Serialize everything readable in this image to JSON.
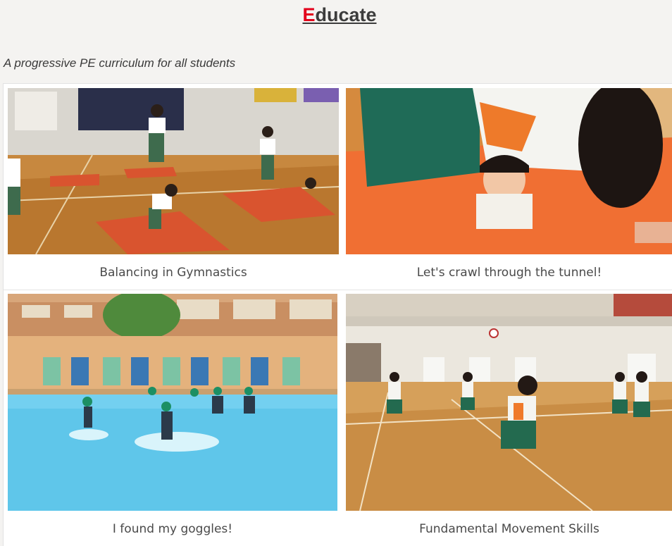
{
  "header": {
    "title_first_letter": "E",
    "title_rest": "ducate",
    "subtitle": "A progressive PE curriculum for all students"
  },
  "gallery": {
    "items": [
      {
        "caption": "Balancing in Gymnastics"
      },
      {
        "caption": "Let's crawl through the tunnel!"
      },
      {
        "caption": "I found my goggles!"
      },
      {
        "caption": "Fundamental Movement Skills"
      }
    ]
  },
  "colors": {
    "title_accent": "#e3001b",
    "title_text": "#3c3c3c",
    "caption_text": "#4a4a4a"
  }
}
